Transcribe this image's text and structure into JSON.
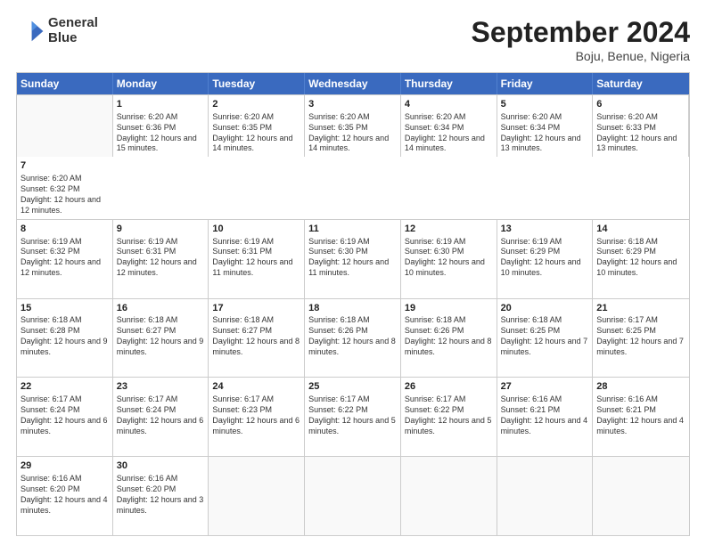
{
  "header": {
    "logo_line1": "General",
    "logo_line2": "Blue",
    "month": "September 2024",
    "location": "Boju, Benue, Nigeria"
  },
  "days": [
    "Sunday",
    "Monday",
    "Tuesday",
    "Wednesday",
    "Thursday",
    "Friday",
    "Saturday"
  ],
  "rows": [
    [
      {
        "day": "",
        "empty": true
      },
      {
        "day": "1",
        "text": "Sunrise: 6:20 AM\nSunset: 6:36 PM\nDaylight: 12 hours\nand 15 minutes."
      },
      {
        "day": "2",
        "text": "Sunrise: 6:20 AM\nSunset: 6:35 PM\nDaylight: 12 hours\nand 14 minutes."
      },
      {
        "day": "3",
        "text": "Sunrise: 6:20 AM\nSunset: 6:35 PM\nDaylight: 12 hours\nand 14 minutes."
      },
      {
        "day": "4",
        "text": "Sunrise: 6:20 AM\nSunset: 6:34 PM\nDaylight: 12 hours\nand 14 minutes."
      },
      {
        "day": "5",
        "text": "Sunrise: 6:20 AM\nSunset: 6:34 PM\nDaylight: 12 hours\nand 13 minutes."
      },
      {
        "day": "6",
        "text": "Sunrise: 6:20 AM\nSunset: 6:33 PM\nDaylight: 12 hours\nand 13 minutes."
      },
      {
        "day": "7",
        "text": "Sunrise: 6:20 AM\nSunset: 6:32 PM\nDaylight: 12 hours\nand 12 minutes."
      }
    ],
    [
      {
        "day": "8",
        "text": "Sunrise: 6:19 AM\nSunset: 6:32 PM\nDaylight: 12 hours\nand 12 minutes."
      },
      {
        "day": "9",
        "text": "Sunrise: 6:19 AM\nSunset: 6:31 PM\nDaylight: 12 hours\nand 12 minutes."
      },
      {
        "day": "10",
        "text": "Sunrise: 6:19 AM\nSunset: 6:31 PM\nDaylight: 12 hours\nand 11 minutes."
      },
      {
        "day": "11",
        "text": "Sunrise: 6:19 AM\nSunset: 6:30 PM\nDaylight: 12 hours\nand 11 minutes."
      },
      {
        "day": "12",
        "text": "Sunrise: 6:19 AM\nSunset: 6:30 PM\nDaylight: 12 hours\nand 10 minutes."
      },
      {
        "day": "13",
        "text": "Sunrise: 6:19 AM\nSunset: 6:29 PM\nDaylight: 12 hours\nand 10 minutes."
      },
      {
        "day": "14",
        "text": "Sunrise: 6:18 AM\nSunset: 6:29 PM\nDaylight: 12 hours\nand 10 minutes."
      }
    ],
    [
      {
        "day": "15",
        "text": "Sunrise: 6:18 AM\nSunset: 6:28 PM\nDaylight: 12 hours\nand 9 minutes."
      },
      {
        "day": "16",
        "text": "Sunrise: 6:18 AM\nSunset: 6:27 PM\nDaylight: 12 hours\nand 9 minutes."
      },
      {
        "day": "17",
        "text": "Sunrise: 6:18 AM\nSunset: 6:27 PM\nDaylight: 12 hours\nand 8 minutes."
      },
      {
        "day": "18",
        "text": "Sunrise: 6:18 AM\nSunset: 6:26 PM\nDaylight: 12 hours\nand 8 minutes."
      },
      {
        "day": "19",
        "text": "Sunrise: 6:18 AM\nSunset: 6:26 PM\nDaylight: 12 hours\nand 8 minutes."
      },
      {
        "day": "20",
        "text": "Sunrise: 6:18 AM\nSunset: 6:25 PM\nDaylight: 12 hours\nand 7 minutes."
      },
      {
        "day": "21",
        "text": "Sunrise: 6:17 AM\nSunset: 6:25 PM\nDaylight: 12 hours\nand 7 minutes."
      }
    ],
    [
      {
        "day": "22",
        "text": "Sunrise: 6:17 AM\nSunset: 6:24 PM\nDaylight: 12 hours\nand 6 minutes."
      },
      {
        "day": "23",
        "text": "Sunrise: 6:17 AM\nSunset: 6:24 PM\nDaylight: 12 hours\nand 6 minutes."
      },
      {
        "day": "24",
        "text": "Sunrise: 6:17 AM\nSunset: 6:23 PM\nDaylight: 12 hours\nand 6 minutes."
      },
      {
        "day": "25",
        "text": "Sunrise: 6:17 AM\nSunset: 6:22 PM\nDaylight: 12 hours\nand 5 minutes."
      },
      {
        "day": "26",
        "text": "Sunrise: 6:17 AM\nSunset: 6:22 PM\nDaylight: 12 hours\nand 5 minutes."
      },
      {
        "day": "27",
        "text": "Sunrise: 6:16 AM\nSunset: 6:21 PM\nDaylight: 12 hours\nand 4 minutes."
      },
      {
        "day": "28",
        "text": "Sunrise: 6:16 AM\nSunset: 6:21 PM\nDaylight: 12 hours\nand 4 minutes."
      }
    ],
    [
      {
        "day": "29",
        "text": "Sunrise: 6:16 AM\nSunset: 6:20 PM\nDaylight: 12 hours\nand 4 minutes."
      },
      {
        "day": "30",
        "text": "Sunrise: 6:16 AM\nSunset: 6:20 PM\nDaylight: 12 hours\nand 3 minutes."
      },
      {
        "day": "",
        "empty": true
      },
      {
        "day": "",
        "empty": true
      },
      {
        "day": "",
        "empty": true
      },
      {
        "day": "",
        "empty": true
      },
      {
        "day": "",
        "empty": true
      }
    ]
  ]
}
